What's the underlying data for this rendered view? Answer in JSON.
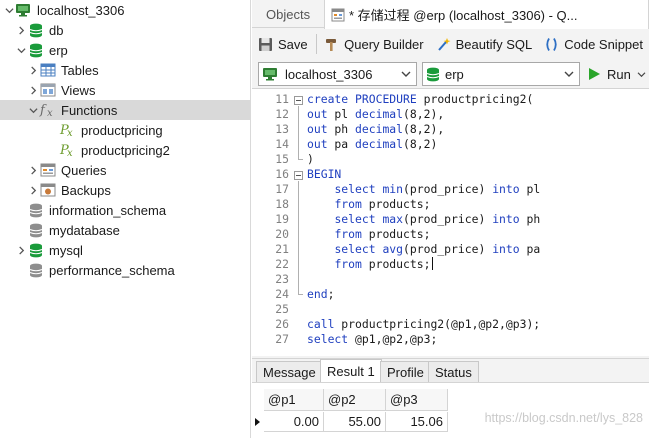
{
  "tree": {
    "items": [
      {
        "label": "localhost_3306"
      },
      {
        "label": "db"
      },
      {
        "label": "erp"
      },
      {
        "label": "Tables"
      },
      {
        "label": "Views"
      },
      {
        "label": "Functions"
      },
      {
        "label": "productpricing"
      },
      {
        "label": "productpricing2"
      },
      {
        "label": "Queries"
      },
      {
        "label": "Backups"
      },
      {
        "label": "information_schema"
      },
      {
        "label": "mydatabase"
      },
      {
        "label": "mysql"
      },
      {
        "label": "performance_schema"
      }
    ]
  },
  "tabs": {
    "objects": "Objects",
    "active": "* 存储过程 @erp (localhost_3306) - Q..."
  },
  "toolbar": {
    "save": "Save",
    "query_builder": "Query Builder",
    "beautify": "Beautify SQL",
    "snippet": "Code Snippet"
  },
  "selectors": {
    "connection": "localhost_3306",
    "database": "erp",
    "run": "Run"
  },
  "editor": {
    "lines": [
      {
        "n": "11",
        "t": "create PROCEDURE productpricing2("
      },
      {
        "n": "12",
        "t": "out pl decimal(8,2),"
      },
      {
        "n": "13",
        "t": "out ph decimal(8,2),"
      },
      {
        "n": "14",
        "t": "out pa decimal(8,2)"
      },
      {
        "n": "15",
        "t": ")"
      },
      {
        "n": "16",
        "t": "BEGIN"
      },
      {
        "n": "17",
        "t": "    select min(prod_price) into pl"
      },
      {
        "n": "18",
        "t": "    from products;"
      },
      {
        "n": "19",
        "t": "    select max(prod_price) into ph"
      },
      {
        "n": "20",
        "t": "    from products;"
      },
      {
        "n": "21",
        "t": "    select avg(prod_price) into pa"
      },
      {
        "n": "22",
        "t": "    from products;"
      },
      {
        "n": "23",
        "t": ""
      },
      {
        "n": "24",
        "t": "end;"
      },
      {
        "n": "25",
        "t": ""
      },
      {
        "n": "26",
        "t": "call productpricing2(@p1,@p2,@p3);"
      },
      {
        "n": "27",
        "t": "select @p1,@p2,@p3;"
      }
    ]
  },
  "result_tabs": {
    "message": "Message",
    "result": "Result 1",
    "profile": "Profile",
    "status": "Status"
  },
  "grid": {
    "headers": [
      "@p1",
      "@p2",
      "@p3"
    ],
    "row": [
      "0.00",
      "55.00",
      "15.06"
    ]
  },
  "watermark": "https://blog.csdn.net/lys_828",
  "colors": {
    "db_green": "#1a9b3b",
    "keyword": "#1f3fbf",
    "selected_row": "#d9d9d9"
  }
}
